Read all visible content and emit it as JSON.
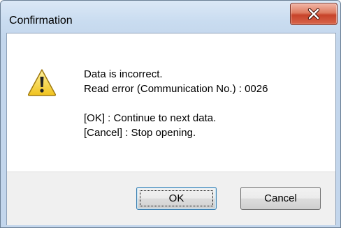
{
  "window": {
    "title": "Confirmation"
  },
  "icons": {
    "message_icon": "warning-icon",
    "close_icon": "close-icon"
  },
  "message": {
    "line1": "Data is incorrect.",
    "line2": "Read error (Communication No.) : 0026",
    "line3": "[OK] : Continue to next data.",
    "line4": "[Cancel] : Stop opening."
  },
  "buttons": {
    "ok_label": "OK",
    "cancel_label": "Cancel"
  },
  "colors": {
    "close_button": "#c7432a",
    "warning_fill": "#f5d64a",
    "default_button_border": "#3c7fb1"
  }
}
